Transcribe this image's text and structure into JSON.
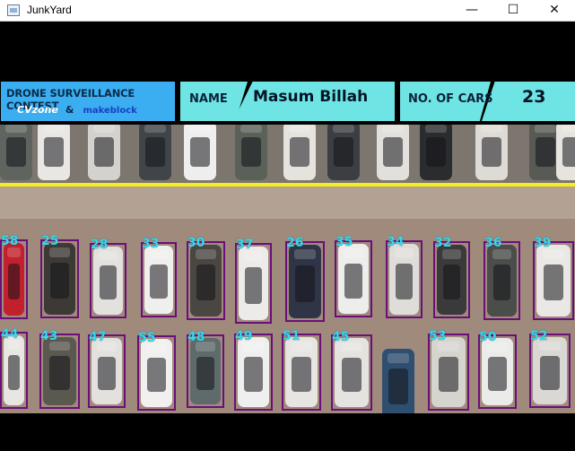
{
  "window": {
    "title": "JunkYard",
    "minimize_glyph": "—",
    "maximize_glyph": "☐",
    "close_glyph": "✕"
  },
  "hud": {
    "contest_title": "DRONE SURVEILLANCE CONTEST",
    "sponsor_1": "CVzone",
    "sponsor_amp": "&",
    "sponsor_2": "makeblock",
    "name_label": "NAME",
    "name_value": "Masum Billah",
    "cars_label": "NO. OF CARS",
    "cars_value": "23",
    "colors": {
      "contest_bg": "#3aaef0",
      "panel_bg": "#6fe4e4",
      "box_color": "#6a0f7a",
      "number_color": "#38d8ef",
      "line_color": "#f4ef1a"
    }
  },
  "detections": {
    "row1": [
      "58",
      "25",
      "28",
      "33",
      "30",
      "37",
      "26",
      "35",
      "34",
      "32",
      "36",
      "39"
    ],
    "row2": [
      "44",
      "43",
      "47",
      "55",
      "48",
      "49",
      "51",
      "45",
      "53",
      "50",
      "52"
    ]
  },
  "top_row_cars": [
    "#5e655f",
    "#e9e7e4",
    "#d4d2cf",
    "#3f4548",
    "#eeeeee",
    "#596159",
    "#e6e3df",
    "#3b3f42",
    "#e2e0dc",
    "#2a2c2e",
    "#dedad6",
    "#575a55",
    "#e7e4e0",
    "#403c38",
    "#ccc8c2"
  ],
  "row1_car_colors": [
    "#c1202c",
    "#3d3a36",
    "#e3e1dd",
    "#efefed",
    "#4a4642",
    "#ecebe9",
    "#2f3547",
    "#ededeb",
    "#deddda",
    "#3a3a3a",
    "#4b4d4a",
    "#e9e8e4"
  ],
  "row2_car_colors": [
    "#e8e6e2",
    "#5b584f",
    "#e3e1de",
    "#f1f0ee",
    "#5f6b6b",
    "#efefef",
    "#e6e5e2",
    "#e4e3df",
    "#2f4f70",
    "#d6d4cf",
    "#ebebe9",
    "#dad8d4"
  ]
}
